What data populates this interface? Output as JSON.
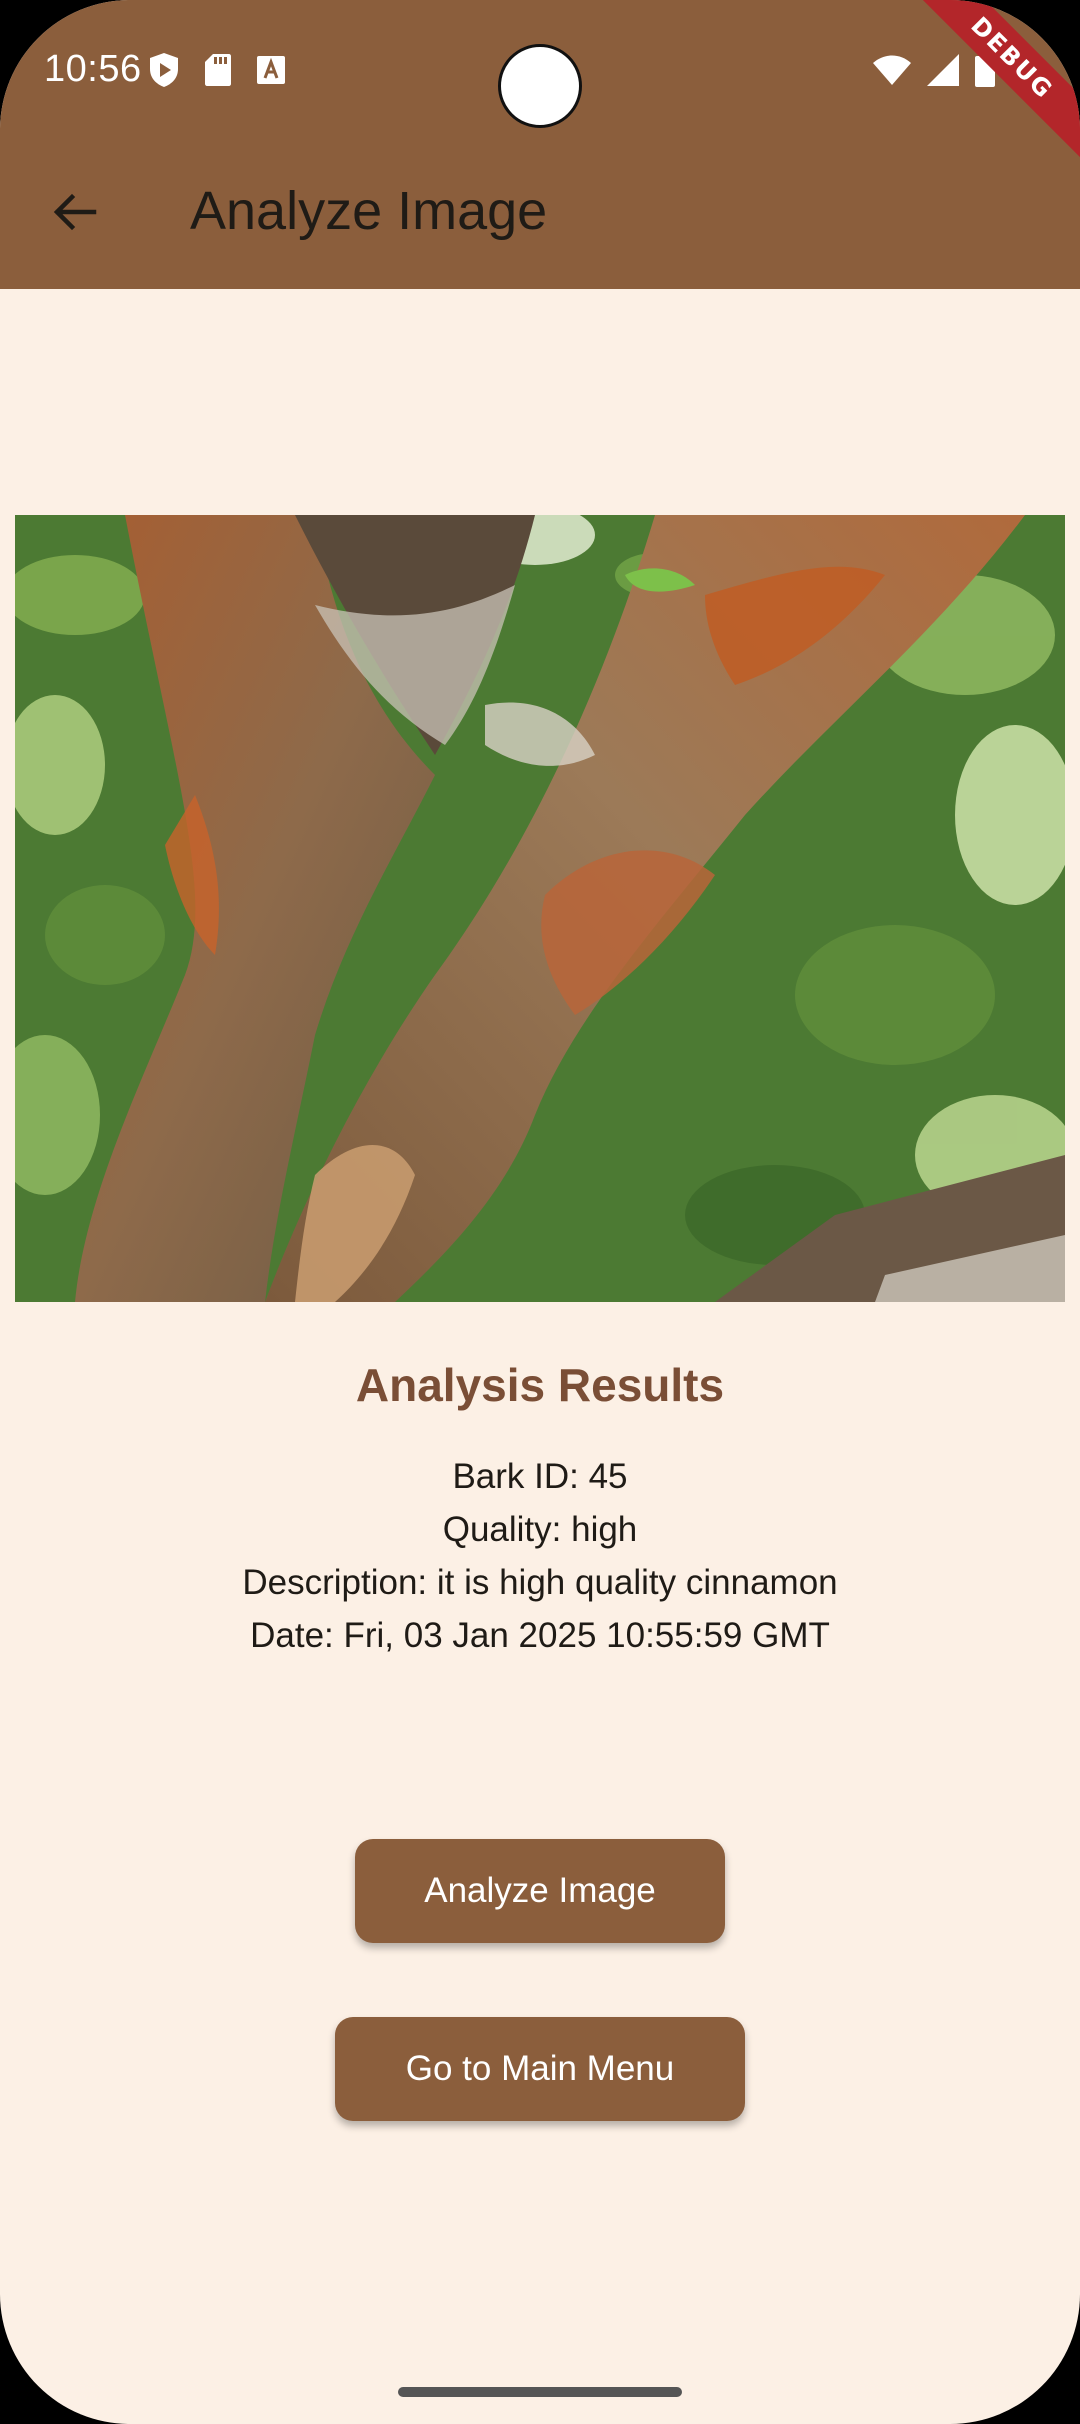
{
  "status_bar": {
    "time": "10:56",
    "icons_left": [
      "play-protect-icon",
      "sd-card-icon",
      "font-a-icon"
    ],
    "icons_right": [
      "wifi-icon",
      "cellular-signal-icon",
      "battery-icon"
    ],
    "debug_label": "DEBUG"
  },
  "app_bar": {
    "back_icon": "arrow-back-icon",
    "title": "Analyze Image"
  },
  "image": {
    "subject": "tree-bark-photo"
  },
  "results": {
    "heading": "Analysis Results",
    "bark_id": "Bark ID: 45",
    "quality": "Quality: high",
    "description": "Description: it is high quality cinnamon",
    "date": "Date: Fri, 03 Jan 2025 10:55:59 GMT"
  },
  "buttons": {
    "analyze_label": "Analyze Image",
    "main_menu_label": "Go to Main Menu"
  },
  "colors": {
    "primary": "#8B5E3C",
    "background": "#FCF0E5",
    "heading": "#7A4E36",
    "debug_banner": "#B3262A"
  }
}
